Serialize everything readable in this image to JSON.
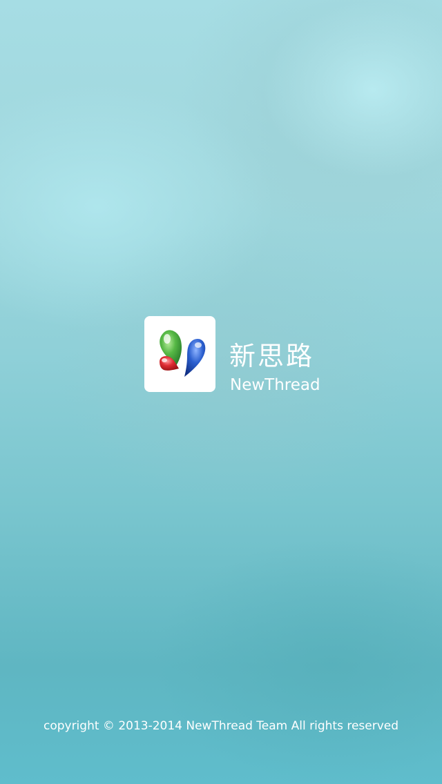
{
  "app": {
    "name_cn": "新思路",
    "name_en": "NewThread"
  },
  "icon": {
    "name": "newthread-logo-icon",
    "colors": {
      "green": "#3aa63a",
      "red": "#d8262b",
      "blue": "#1e4fb8",
      "background": "#ffffff"
    }
  },
  "footer": {
    "copyright": "copyright © 2013-2014 NewThread Team All rights reserved"
  },
  "theme": {
    "background_top": "#a6dde4",
    "background_bottom": "#5fb6c2",
    "text": "#ffffff"
  }
}
